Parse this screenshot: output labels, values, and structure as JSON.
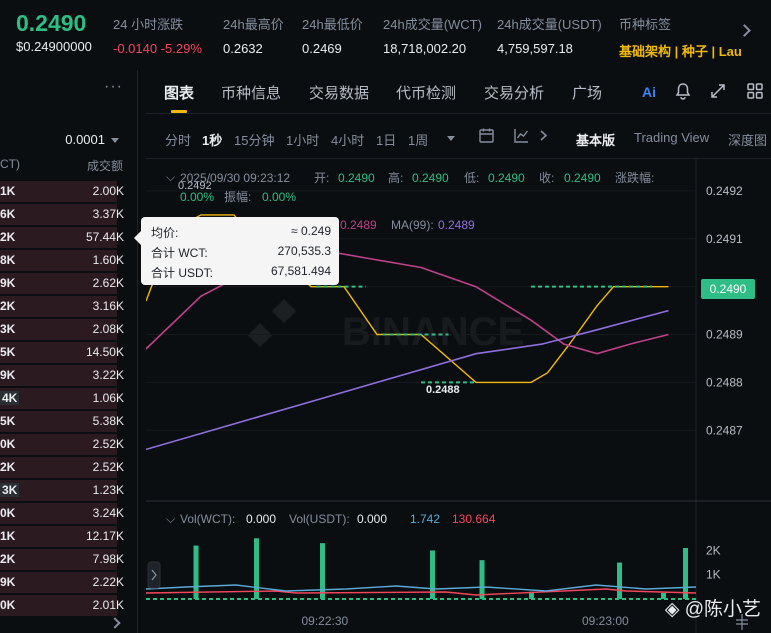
{
  "ticker": {
    "price": "0.2490",
    "price_usd": "$0.24900000",
    "change_label": "24 小时涨跌",
    "change_value": "-0.0140 -5.29%",
    "high_label": "24h最高价",
    "high_value": "0.2632",
    "low_label": "24h最低价",
    "low_value": "0.2469",
    "vol_wct_label": "24h成交量(WCT)",
    "vol_wct_value": "18,718,002.20",
    "vol_usdt_label": "24h成交量(USDT)",
    "vol_usdt_value": "4,759,597.18",
    "tag_label": "币种标签",
    "tag_value": "基础架构 | 种子 | Lau"
  },
  "orderbook": {
    "menu": "···",
    "step": "0.0001",
    "col_price": "CT)",
    "col_total": "成交额",
    "rows": [
      {
        "p": "1K",
        "q": "2.00K",
        "bar": 0.85
      },
      {
        "p": "6K",
        "q": "3.37K",
        "bar": 0.85
      },
      {
        "p": "2K",
        "q": "57.44K",
        "bar": 0.85
      },
      {
        "p": "8K",
        "q": "1.60K",
        "bar": 0.85
      },
      {
        "p": "9K",
        "q": "2.62K",
        "bar": 0.85
      },
      {
        "p": "2K",
        "q": "3.16K",
        "bar": 0.85
      },
      {
        "p": "3K",
        "q": "2.08K",
        "bar": 0.85
      },
      {
        "p": "5K",
        "q": "14.50K",
        "bar": 0.85
      },
      {
        "p": "9K",
        "q": "3.22K",
        "bar": 0.85
      },
      {
        "p": "4K",
        "q": "1.06K",
        "bar": 0.85,
        "hl": true
      },
      {
        "p": "5K",
        "q": "5.38K",
        "bar": 0.85
      },
      {
        "p": "0K",
        "q": "2.52K",
        "bar": 0.85
      },
      {
        "p": "2K",
        "q": "2.52K",
        "bar": 0.85
      },
      {
        "p": "3K",
        "q": "1.23K",
        "bar": 0.85,
        "hl": true
      },
      {
        "p": "0K",
        "q": "3.24K",
        "bar": 0.85
      },
      {
        "p": "1K",
        "q": "12.17K",
        "bar": 0.85
      },
      {
        "p": "2K",
        "q": "7.98K",
        "bar": 0.85
      },
      {
        "p": "9K",
        "q": "2.22K",
        "bar": 0.85
      },
      {
        "p": "0K",
        "q": "2.01K",
        "bar": 0.85
      }
    ]
  },
  "tabs": [
    "图表",
    "币种信息",
    "交易数据",
    "代币检测",
    "交易分析",
    "广场"
  ],
  "tab_icons": {
    "ai": "Ai",
    "bell": "bell-icon",
    "expand": "expand-icon",
    "grid": "grid-icon"
  },
  "toolbar": {
    "intervals": [
      "分时",
      "1秒",
      "15分钟",
      "1小时",
      "4小时",
      "1日",
      "1周"
    ],
    "active_interval": "1秒",
    "views": [
      "基本版",
      "Trading View",
      "深度图"
    ]
  },
  "chart_info": {
    "datetime": "2025/09/30 09:23:12",
    "open_label": "开:",
    "open": "0.2490",
    "high_label": "高:",
    "high": "0.2490",
    "low_label": "低:",
    "low": "0.2490",
    "close_label": "收:",
    "close": "0.2490",
    "change_label": "涨跌幅:",
    "change": "0.00%",
    "amp_label": "振幅:",
    "amp": "0.00%",
    "ma1_val": "0.2489",
    "ma2_label": "MA(99):",
    "ma2_val": "0.2489",
    "max_marker": "0.2492",
    "min_marker": "0.2488",
    "current_price": "0.2490"
  },
  "tooltip": {
    "avg_label": "均价:",
    "avg_value": "≈ 0.249",
    "wct_label": "合计 WCT:",
    "wct_value": "270,535.3",
    "usdt_label": "合计 USDT:",
    "usdt_value": "67,581.494"
  },
  "volume_info": {
    "wct_label": "Vol(WCT):",
    "wct_value": "0.000",
    "usdt_label": "Vol(USDT):",
    "usdt_value": "0.000",
    "ma1": "1.742",
    "ma2": "130.664"
  },
  "colors": {
    "up": "#2ebd85",
    "down": "#f6465d",
    "accent": "#f0b90b",
    "ma_pink": "#c0408a",
    "ma_purple": "#8f6fe0",
    "vol_ma_blue": "#5aa9d6"
  },
  "chart_data": {
    "type": "line",
    "price_axis": {
      "ticks": [
        "0.2492",
        "0.2491",
        "0.2490",
        "0.2489",
        "0.2488",
        "0.2487"
      ],
      "range": [
        0.24864,
        0.24925
      ]
    },
    "time_axis": {
      "ticks": [
        "09:22:30",
        "09:23:00"
      ]
    },
    "series": [
      {
        "type": "step",
        "color": "#f0b90b",
        "points": [
          [
            0,
            0.24897
          ],
          [
            0.05,
            0.24912
          ],
          [
            0.1,
            0.24915
          ],
          [
            0.16,
            0.24915
          ],
          [
            0.21,
            0.24908
          ],
          [
            0.26,
            0.24904
          ],
          [
            0.3,
            0.249
          ],
          [
            0.36,
            0.249
          ],
          [
            0.42,
            0.2489
          ],
          [
            0.5,
            0.2489
          ],
          [
            0.6,
            0.2488
          ],
          [
            0.7,
            0.2488
          ],
          [
            0.73,
            0.24882
          ],
          [
            0.77,
            0.24888
          ],
          [
            0.82,
            0.24896
          ],
          [
            0.85,
            0.249
          ],
          [
            0.95,
            0.249
          ]
        ]
      },
      {
        "type": "ma",
        "color": "#c0408a",
        "points": [
          [
            0,
            0.24887
          ],
          [
            0.1,
            0.24898
          ],
          [
            0.2,
            0.24904
          ],
          [
            0.3,
            0.24908
          ],
          [
            0.4,
            0.24906
          ],
          [
            0.5,
            0.24904
          ],
          [
            0.6,
            0.249
          ],
          [
            0.7,
            0.24893
          ],
          [
            0.76,
            0.24888
          ],
          [
            0.82,
            0.24886
          ],
          [
            0.88,
            0.24888
          ],
          [
            0.95,
            0.2489
          ]
        ]
      },
      {
        "type": "ma",
        "color": "#8f6fe0",
        "points": [
          [
            0,
            0.24866
          ],
          [
            0.15,
            0.24871
          ],
          [
            0.3,
            0.24876
          ],
          [
            0.45,
            0.24881
          ],
          [
            0.6,
            0.24886
          ],
          [
            0.72,
            0.24888
          ],
          [
            0.82,
            0.24891
          ],
          [
            0.95,
            0.24895
          ]
        ]
      }
    ],
    "volume": {
      "ticks": [
        "2K",
        "1K"
      ],
      "bars": [
        [
          0.09,
          2.2
        ],
        [
          0.2,
          2.5
        ],
        [
          0.32,
          2.3
        ],
        [
          0.52,
          2.0
        ],
        [
          0.61,
          1.6
        ],
        [
          0.7,
          0.3
        ],
        [
          0.86,
          1.5
        ],
        [
          0.94,
          0.25
        ],
        [
          0.98,
          2.1
        ]
      ]
    }
  },
  "watermark": "◈ @陈小艺"
}
